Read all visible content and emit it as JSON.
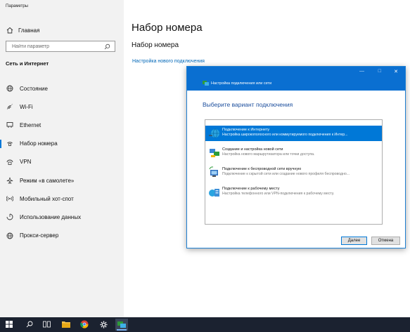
{
  "window": {
    "title": "Параметры"
  },
  "sidebar": {
    "home_label": "Главная",
    "search_placeholder": "Найти параметр",
    "section_title": "Сеть и Интернет",
    "items": [
      {
        "label": "Состояние",
        "icon": "globe-icon"
      },
      {
        "label": "Wi-Fi",
        "icon": "wifi-icon"
      },
      {
        "label": "Ethernet",
        "icon": "ethernet-icon"
      },
      {
        "label": "Набор номера",
        "icon": "dialup-icon",
        "active": true
      },
      {
        "label": "VPN",
        "icon": "vpn-icon"
      },
      {
        "label": "Режим «в самолете»",
        "icon": "airplane-icon"
      },
      {
        "label": "Мобильный хот-спот",
        "icon": "hotspot-icon"
      },
      {
        "label": "Использование данных",
        "icon": "data-usage-icon"
      },
      {
        "label": "Прокси-сервер",
        "icon": "proxy-icon"
      }
    ]
  },
  "main": {
    "title": "Набор номера",
    "subtitle": "Набор номера",
    "link": "Настройка нового подключения"
  },
  "dialog": {
    "title": "Настройка подключения или сети",
    "heading": "Выберите вариант подключения",
    "options": [
      {
        "title": "Подключение к Интернету",
        "desc": "Настройка широкополосного или коммутируемого подключения к Интер...",
        "selected": true
      },
      {
        "title": "Создание и настройка новой сети",
        "desc": "Настройка нового маршрутизатора или точки доступа."
      },
      {
        "title": "Подключение к беспроводной сети вручную",
        "desc": "Подключение к скрытой сети или создание нового профиля беспроводно..."
      },
      {
        "title": "Подключение к рабочему месту",
        "desc": "Настройка телефонного или VPN-подключения к рабочему месту."
      }
    ],
    "next_button": "Далее",
    "cancel_button": "Отмена"
  },
  "taskbar": {
    "items": [
      "start-icon",
      "search-icon",
      "task-view-icon",
      "file-explorer-icon",
      "chrome-icon",
      "settings-icon",
      "network-setup-icon"
    ]
  },
  "colors": {
    "accent": "#0078d7",
    "dialog_header": "#0a6fd1",
    "link": "#0067b8",
    "sidebar_bg": "#f2f2f2",
    "taskbar_bg": "#1b2230"
  }
}
